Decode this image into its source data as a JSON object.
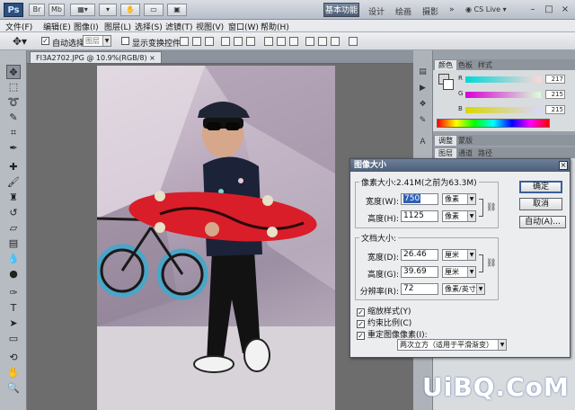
{
  "title_bar": {
    "logo": "Ps",
    "workspace": "基本功能",
    "workspace_links": [
      "设计",
      "绘画",
      "摄影"
    ],
    "cs_live": "CS Live",
    "more": "»",
    "minimize": "–",
    "maximize": "□",
    "close": "×"
  },
  "menu": [
    "文件(F)",
    "编辑(E)",
    "图像(I)",
    "图层(L)",
    "选择(S)",
    "滤镜(T)",
    "视图(V)",
    "窗口(W)",
    "帮助(H)"
  ],
  "options": {
    "auto_select_label": "自动选择:",
    "auto_select_value": "图层",
    "show_transform_label": "显示变换控件"
  },
  "document": {
    "tab_label": "FI3A2702.JPG @ 10.9%(RGB/8)"
  },
  "panels": {
    "color_tabs": [
      "颜色",
      "色板",
      "样式"
    ],
    "color_values": [
      "217",
      "215",
      "215"
    ],
    "color_letters": [
      "R",
      "G",
      "B"
    ],
    "adjust_tabs": [
      "调整",
      "蒙版"
    ],
    "layer_tabs": [
      "图层",
      "通道",
      "路径"
    ]
  },
  "dialog": {
    "title": "图像大小",
    "close": "×",
    "pixel_group": "像素大小:2.41M(之前为63.3M)",
    "width_label": "宽度(W):",
    "width_value": "750",
    "width_unit": "像素",
    "height_label": "高度(H):",
    "height_value": "1125",
    "height_unit": "像素",
    "doc_group": "文档大小:",
    "doc_width_label": "宽度(D):",
    "doc_width_value": "26.46",
    "doc_width_unit": "厘米",
    "doc_height_label": "高度(G):",
    "doc_height_value": "39.69",
    "doc_height_unit": "厘米",
    "res_label": "分辨率(R):",
    "res_value": "72",
    "res_unit": "像素/英寸",
    "ok": "确定",
    "cancel": "取消",
    "auto": "自动(A)...",
    "scale_styles": "缩放样式(Y)",
    "constrain": "约束比例(C)",
    "resample": "重定图像像素(I):",
    "resample_method": "两次立方（适用于平滑渐变）",
    "check": "✓"
  },
  "watermark": "UiBQ.CoM"
}
